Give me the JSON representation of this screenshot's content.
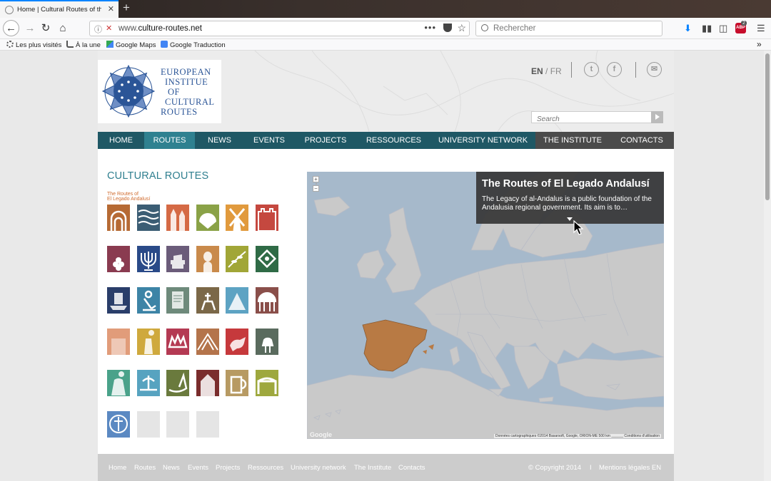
{
  "browser": {
    "tab_title": "Home | Cultural Routes of the C",
    "tab_close": "✕",
    "new_tab": "+",
    "url_prefix": "www.",
    "url_domain": "culture-routes.net",
    "url_dots": "•••",
    "search_placeholder": "Rechercher",
    "addon_badge": "2",
    "bookmarks": [
      {
        "label": "Les plus visités",
        "icon": "gear-icon"
      },
      {
        "label": "À la une",
        "icon": "rss-icon"
      },
      {
        "label": "Google Maps",
        "icon": "maps-icon"
      },
      {
        "label": "Google Traduction",
        "icon": "translate-icon"
      }
    ],
    "overflow": "»"
  },
  "header": {
    "logo_lines": [
      "EUROPEAN",
      "INSTITUE",
      "OF",
      "CULTURAL",
      "ROUTES"
    ],
    "lang_en": "EN",
    "lang_sep": "/",
    "lang_fr": "FR",
    "search_placeholder": "Search",
    "social": {
      "twitter": "t",
      "facebook": "f",
      "mail": "✉"
    }
  },
  "nav": [
    {
      "label": "HOME",
      "state": "normal"
    },
    {
      "label": "ROUTES",
      "state": "active"
    },
    {
      "label": "NEWS",
      "state": "normal"
    },
    {
      "label": "EVENTS",
      "state": "normal"
    },
    {
      "label": "PROJECTS",
      "state": "normal"
    },
    {
      "label": "RESSOURCES",
      "state": "normal"
    },
    {
      "label": "UNIVERSITY NETWORK",
      "state": "normal"
    },
    {
      "label": "THE INSTITUTE",
      "state": "gray"
    },
    {
      "label": "CONTACTS",
      "state": "gray"
    }
  ],
  "main": {
    "section_title": "CULTURAL ROUTES",
    "route_label_line1": "The Routes of",
    "route_label_line2": "El Legado Andalusí",
    "tile_colors": [
      "#b66a34",
      "#3b5d74",
      "#d56a45",
      "#8aa247",
      "#e19a3d",
      "#c5483f",
      "#8a3b50",
      "#2a4a88",
      "#6b5c7a",
      "#c98a4b",
      "#a1a637",
      "#2f6b46",
      "#2a3e6a",
      "#3d84a6",
      "#6e8a7b",
      "#7b6848",
      "#5da3c3",
      "#8a4f4a",
      "#e19c7a",
      "#cfa93d",
      "#b43a53",
      "#b4744b",
      "#c6393c",
      "#5a6b5e",
      "#4aa28a",
      "#57a3c0",
      "#6a7a3d",
      "#7a2d2d",
      "#b79a63",
      "#9ea83e",
      "#5b89c2",
      "#e5e5e5",
      "#e5e5e5",
      "#e5e5e5"
    ],
    "tile_icons": [
      "arches-icon",
      "waves-icon",
      "towers-icon",
      "scallop-shell-icon",
      "windmill-icon",
      "castle-icon",
      "grapes-icon",
      "menorah-icon",
      "books-icon",
      "portrait-icon",
      "olive-branch-icon",
      "pattern-icon",
      "ship-icon",
      "blacksmith-icon",
      "manuscript-icon",
      "knight-icon",
      "mont-saint-michel-icon",
      "rotunda-icon",
      "ruins-icon",
      "statue-icon",
      "crown-icon",
      "vault-icon",
      "bull-icon",
      "bird-icon",
      "madonna-icon",
      "fountain-icon",
      "viking-ship-icon",
      "fortress-icon",
      "mug-icon",
      "dolmen-icon",
      "pilgrim-icon",
      "empty-tile",
      "empty-tile",
      "empty-tile"
    ]
  },
  "map": {
    "popup_title": "The Routes of El Legado Andalusí",
    "popup_desc": "The Legacy of al-Andalus is a public foundation of the Andalusia regional government. Its aim is to…",
    "zoom_in": "+",
    "zoom_out": "−",
    "credit": "Données cartographiques ©2014 Basarsoft, Google, ORION-ME   500 km ______   Conditions d'utilisation",
    "google_logo": "Google",
    "colors": {
      "sea": "#a6b9cb",
      "land": "#c9c9c9",
      "highlight": "#b87a44"
    }
  },
  "footer": {
    "links": [
      "Home",
      "Routes",
      "News",
      "Events",
      "Projects",
      "Ressources",
      "University network",
      "The Institute",
      "Contacts"
    ],
    "copyright": "© Copyright 2014",
    "sep": "I",
    "legal": "Mentions légales EN"
  }
}
